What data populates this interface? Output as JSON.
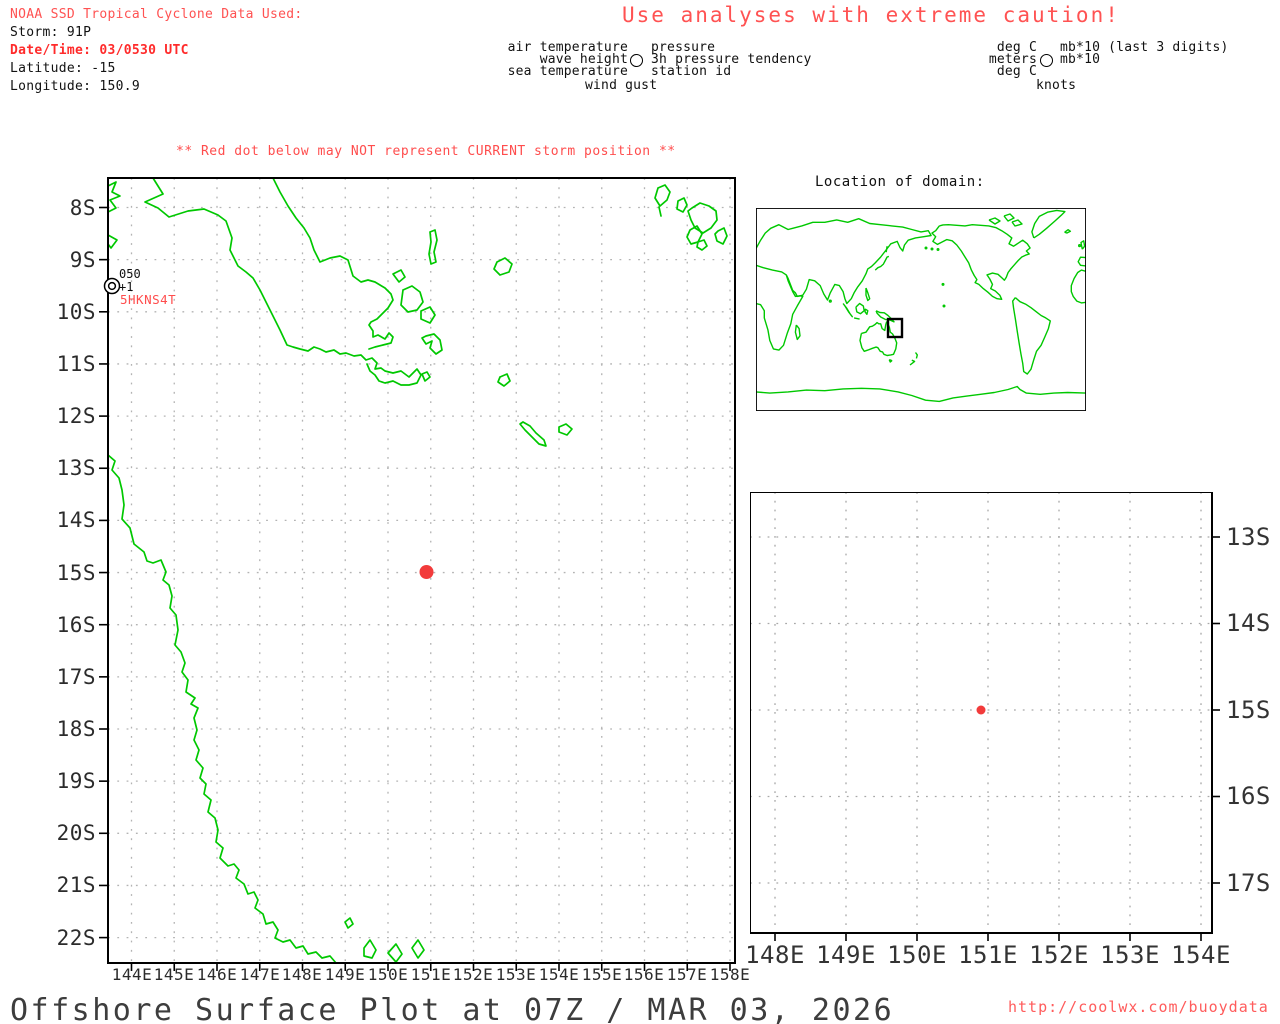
{
  "header": {
    "line1": "NOAA SSD Tropical Cyclone Data Used:",
    "line2": "Storm: 91P",
    "line3": "Date/Time: 03/0530 UTC",
    "line4": "Latitude: -15",
    "line5": "Longitude: 150.9"
  },
  "caution": "Use analyses with extreme caution!",
  "warning": "** Red dot below may NOT represent CURRENT storm position **",
  "plot_legend": {
    "air_temperature": "air temperature",
    "wave_height": "wave height",
    "sea_temperature": "sea temperature",
    "wind_gust": "wind gust",
    "pressure": "pressure",
    "pressure_tendency": "3h pressure tendency",
    "station_id": "station id"
  },
  "units_legend": {
    "deg_c_air": "deg C",
    "meters": "meters",
    "deg_c_sea": "deg C",
    "knots": "knots",
    "mb10_last3": "mb*10 (last 3 digits)",
    "mb10": "mb*10"
  },
  "main_map": {
    "y_labels": [
      "8S",
      "9S",
      "10S",
      "11S",
      "12S",
      "13S",
      "14S",
      "15S",
      "16S",
      "17S",
      "18S",
      "19S",
      "20S",
      "21S",
      "22S"
    ],
    "x_labels": [
      "144E",
      "145E",
      "146E",
      "147E",
      "148E",
      "149E",
      "150E",
      "151E",
      "152E",
      "153E",
      "154E",
      "155E",
      "156E",
      "157E",
      "158E"
    ],
    "station": {
      "pressure_last3": "050",
      "tendency": "+1",
      "id": "5HKNS4T"
    },
    "storm_dot": {
      "lon": 150.9,
      "lat": -15
    }
  },
  "world_map": {
    "title": "Location of domain:",
    "domain_box": "144E-159E, 8S-23S"
  },
  "inset_map": {
    "y_labels": [
      "13S",
      "14S",
      "15S",
      "16S",
      "17S"
    ],
    "x_labels": [
      "148E",
      "149E",
      "150E",
      "151E",
      "152E",
      "153E",
      "154E"
    ],
    "storm_dot": {
      "lon": 150.9,
      "lat": -15
    }
  },
  "footer": {
    "title": "Offshore Surface Plot at 07Z / MAR 03, 2026",
    "url": "http://coolwx.com/buoydata"
  },
  "colors": {
    "coastline_green": "#00c800",
    "alert_red": "#ff5252",
    "storm_dot_red": "#f23b3b",
    "grid_gray": "#b3b3b3"
  }
}
